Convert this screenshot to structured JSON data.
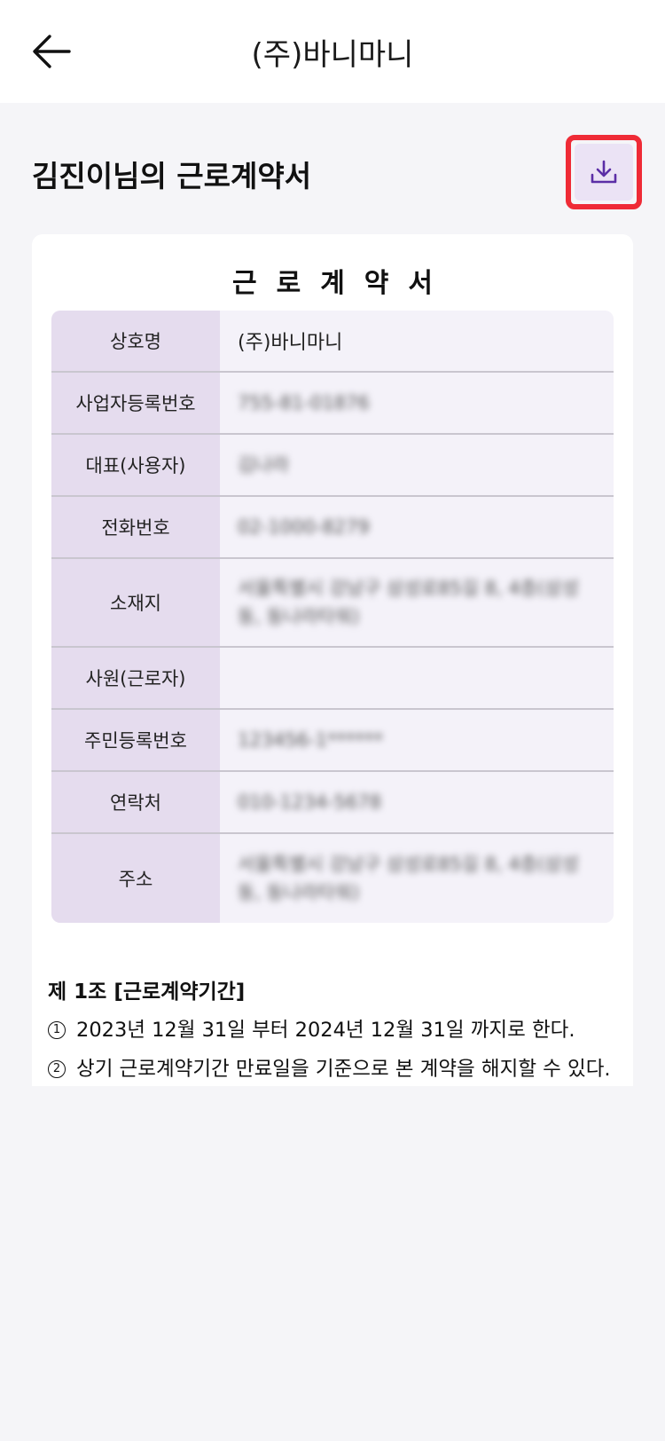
{
  "header": {
    "title": "(주)바니마니",
    "back_icon": "arrow-left-icon"
  },
  "page": {
    "title": "김진이님의 근로계약서",
    "download_icon": "download-icon",
    "colors": {
      "accent": "#5b2ea6",
      "highlight_border": "#ef2b36",
      "download_bg": "#ebe3f5"
    }
  },
  "document": {
    "heading": "근로계약서",
    "rows": [
      {
        "label": "상호명",
        "value": "(주)바니마니",
        "blurred": false
      },
      {
        "label": "사업자등록번호",
        "value": "755-81-01876",
        "blurred": true
      },
      {
        "label": "대표(사용자)",
        "value": "김나라",
        "blurred": true
      },
      {
        "label": "전화번호",
        "value": "02-1000-8279",
        "blurred": true
      },
      {
        "label": "소재지",
        "value": "서울특별시 강남구 삼성로85길 8, 4층(삼성동, 동나라타워)",
        "blurred": true
      },
      {
        "label": "사원(근로자)",
        "value": "",
        "blurred": false
      },
      {
        "label": "주민등록번호",
        "value": "123456-1******",
        "blurred": true
      },
      {
        "label": "연락처",
        "value": "010-1234-5678",
        "blurred": true
      },
      {
        "label": "주소",
        "value": "서울특별시 강남구 삼성로85길 8, 4층(삼성동, 동나라타워)",
        "blurred": true
      }
    ],
    "article": {
      "title": "제 1조 [근로계약기간]",
      "clauses": [
        {
          "num": "1",
          "text": "2023년 12월 31일 부터 2024년 12월 31일 까지로 한다."
        },
        {
          "num": "2",
          "text": "상기 근로계약기간 만료일을 기준으로 본 계약을 해지할 수 있다. 단 당사자 간에 별도의 의사표시가 없는 경우 자동 갱신된"
        }
      ]
    }
  }
}
